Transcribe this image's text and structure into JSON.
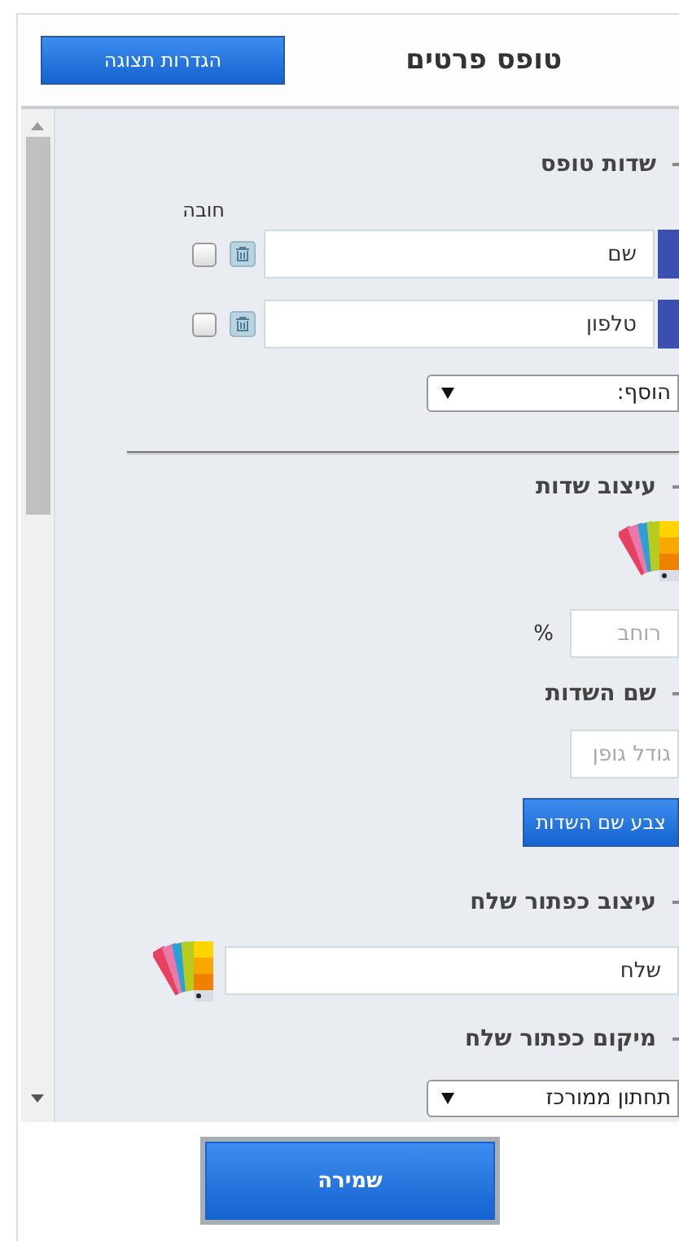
{
  "header": {
    "title": "טופס פרטים",
    "settings_button": "הגדרות תצוגה"
  },
  "form_fields": {
    "heading": "שדות טופס",
    "required_label": "חובה",
    "fields": [
      {
        "value": "שם",
        "required": false
      },
      {
        "value": "טלפון",
        "required": false
      }
    ],
    "add_select": "הוסף:"
  },
  "field_design": {
    "heading": "עיצוב שדות",
    "width_placeholder": "רוחב",
    "width_unit": "%"
  },
  "field_names": {
    "heading": "שם השדות",
    "font_size_placeholder": "גודל גופן",
    "color_button": "צבע שם השדות"
  },
  "submit_design": {
    "heading": "עיצוב כפתור שלח",
    "value": "שלח"
  },
  "submit_position": {
    "heading": "מיקום כפתור שלח",
    "value": "תחתון ממורכז"
  },
  "save_button": "שמירה"
}
